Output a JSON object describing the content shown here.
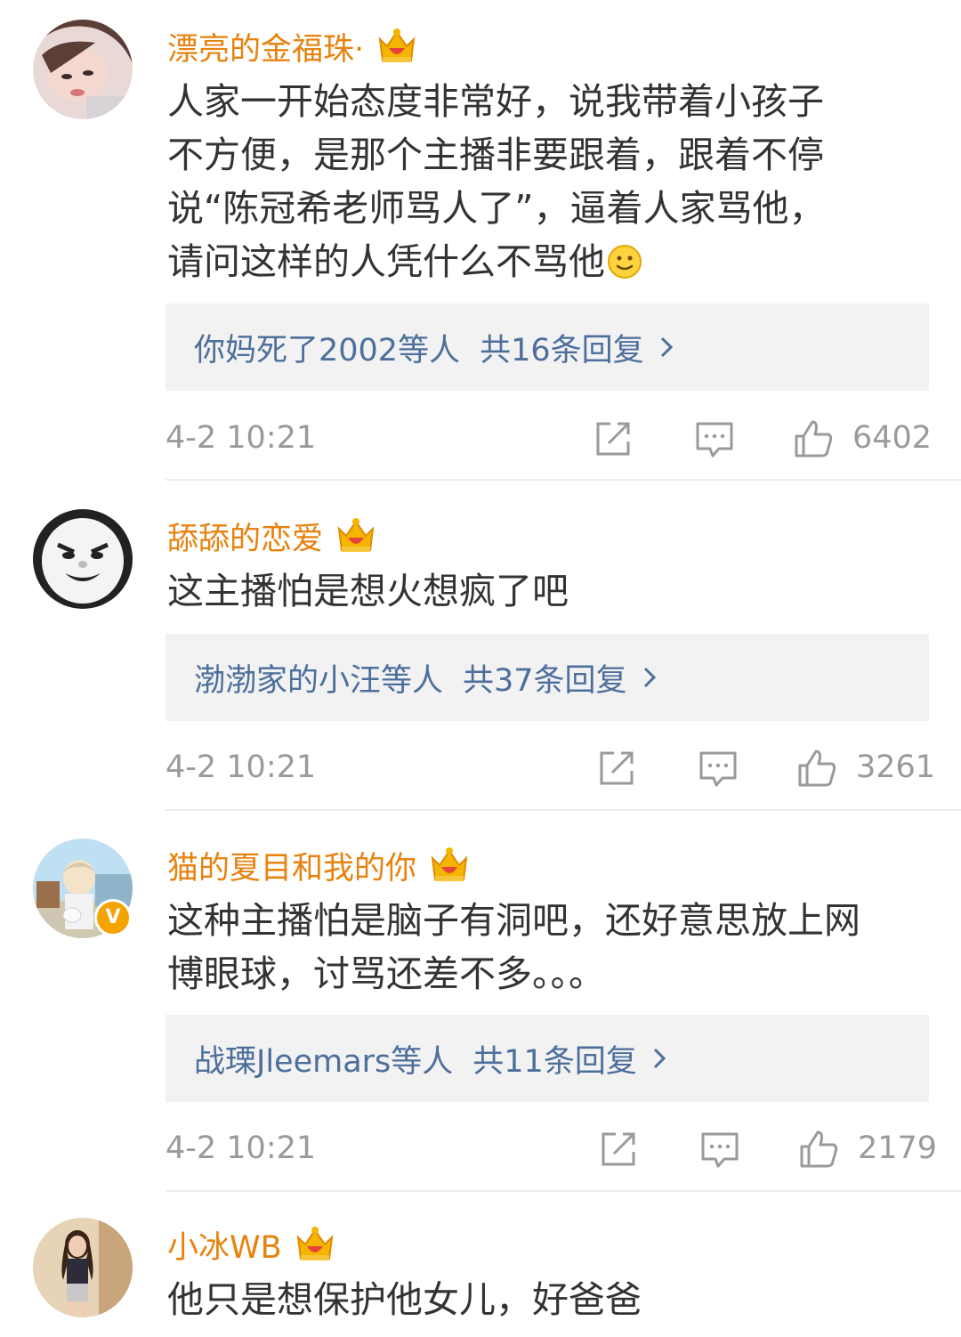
{
  "comments": [
    {
      "username": "漂亮的金福珠·",
      "avatar_icon": "avatar-girl-icon",
      "text": "人家一开始态度非常好，说我带着小孩子\n不方便，是那个主播非要跟着，跟着不停\n说“陈冠希老师骂人了”，逼着人家骂他，\n请问这样的人凭什么不骂他",
      "emoji": "smiley-emoji",
      "reply_names": "你妈死了2002等人",
      "reply_total": "共16条回复",
      "time": "4-2 10:21",
      "likes": "6402"
    },
    {
      "username": "舔舔的恋爱",
      "avatar_icon": "avatar-meme-face-icon",
      "text": "这主播怕是想火想疯了吧",
      "reply_names": "渤渤家的小汪等人",
      "reply_total": "共37条回复",
      "time": "4-2 10:21",
      "likes": "3261"
    },
    {
      "username": "猫的夏目和我的你",
      "avatar_icon": "avatar-anime-icon",
      "verified": "V",
      "text": "这种主播怕是脑子有洞吧，还好意思放上网\n博眼球，讨骂还差不多。。。",
      "reply_names": "战瑮Jleemars等人",
      "reply_total": "共11条回复",
      "time": "4-2 10:21",
      "likes": "2179"
    },
    {
      "username": "小冰WB",
      "avatar_icon": "avatar-girl-photo-icon",
      "text": "他只是想保护他女儿，好爸爸"
    }
  ],
  "colors": {
    "username": "#e8820e",
    "reply_link": "#4c6f9b",
    "meta": "#9a9a9a",
    "reply_bg": "#f2f2f2",
    "crown": "#f5b400",
    "verified_badge": "#f5a300"
  }
}
